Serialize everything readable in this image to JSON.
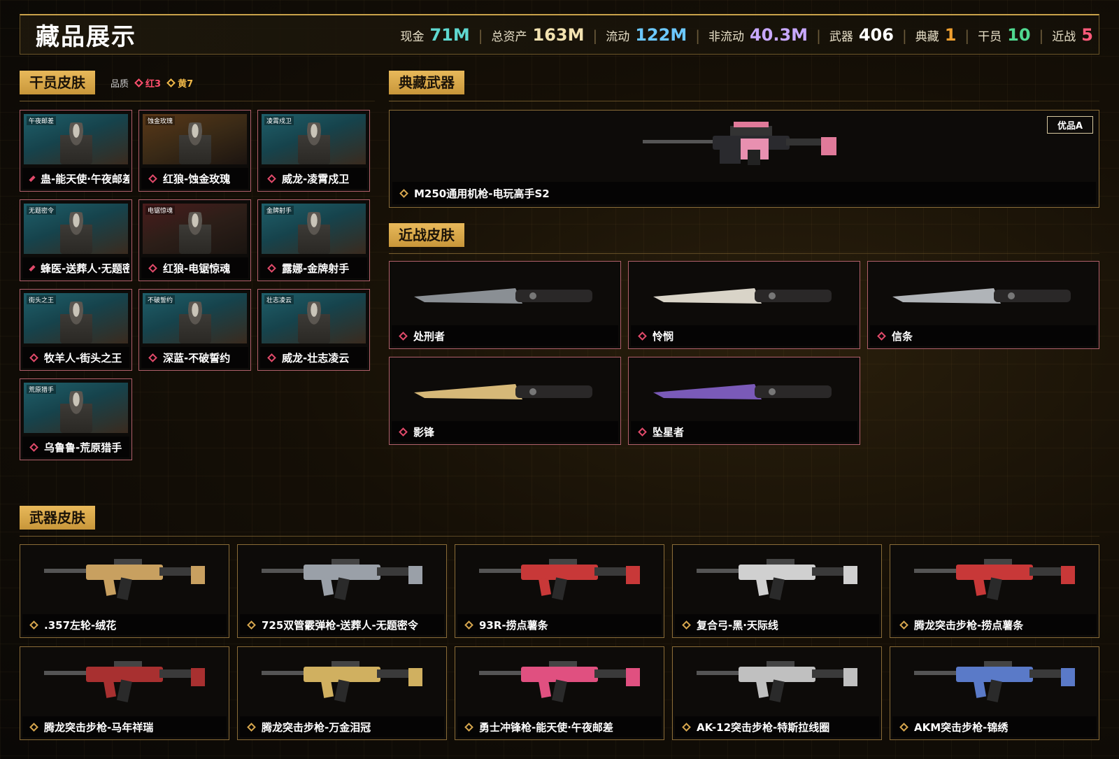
{
  "header": {
    "title": "藏品展示",
    "stats": [
      {
        "label": "现金",
        "value": "71M",
        "color": "#5fd8d0"
      },
      {
        "label": "总资产",
        "value": "163M",
        "color": "#f2e2b0"
      },
      {
        "label": "流动",
        "value": "122M",
        "color": "#6cc8ff"
      },
      {
        "label": "非流动",
        "value": "40.3M",
        "color": "#c8a8ff"
      },
      {
        "label": "武器",
        "value": "406",
        "color": "#ffffff"
      },
      {
        "label": "典藏",
        "value": "1",
        "color": "#f0a030"
      },
      {
        "label": "干员",
        "value": "10",
        "color": "#50d890"
      },
      {
        "label": "近战",
        "value": "5",
        "color": "#ff5a7a"
      }
    ]
  },
  "operator_section": {
    "title": "干员皮肤",
    "quality_label": "品质",
    "quality_red": "红3",
    "quality_yellow": "黄7",
    "items": [
      {
        "label": "蛊-能天使·午夜邮差",
        "tag": "午夜邮差"
      },
      {
        "label": "红狼-蚀金玫瑰",
        "tag": "蚀金玫瑰"
      },
      {
        "label": "威龙-凌霄戍卫",
        "tag": "凌霄戍卫"
      },
      {
        "label": "蜂医-送葬人·无题密令",
        "tag": "无题密令"
      },
      {
        "label": "红狼-电锯惊魂",
        "tag": "电锯惊魂"
      },
      {
        "label": "露娜-金牌射手",
        "tag": "金牌射手"
      },
      {
        "label": "牧羊人-街头之王",
        "tag": "街头之王"
      },
      {
        "label": "深蓝-不破誓约",
        "tag": "不破誓约"
      },
      {
        "label": "威龙-壮志凌云",
        "tag": "壮志凌云"
      },
      {
        "label": "乌鲁鲁-荒原猎手",
        "tag": "荒原猎手"
      }
    ]
  },
  "collection_section": {
    "title": "典藏武器",
    "item_label": "M250通用机枪-电玩高手S2",
    "badge": "优品A"
  },
  "melee_section": {
    "title": "近战皮肤",
    "items": [
      {
        "label": "处刑者"
      },
      {
        "label": "怜悯"
      },
      {
        "label": "信条"
      },
      {
        "label": "影锋"
      },
      {
        "label": "坠星者"
      }
    ]
  },
  "weapon_section": {
    "title": "武器皮肤",
    "items": [
      {
        "label": ".357左轮-绒花"
      },
      {
        "label": "725双管霰弹枪-送葬人-无题密令"
      },
      {
        "label": "93R-捞点薯条"
      },
      {
        "label": "复合弓-黑·天际线"
      },
      {
        "label": "腾龙突击步枪-捞点薯条"
      },
      {
        "label": "腾龙突击步枪-马年祥瑞"
      },
      {
        "label": "腾龙突击步枪-万金泪冠"
      },
      {
        "label": "勇士冲锋枪-能天使·午夜邮差"
      },
      {
        "label": "AK-12突击步枪-特斯拉线圈"
      },
      {
        "label": "AKM突击步枪-锦绣"
      }
    ]
  }
}
